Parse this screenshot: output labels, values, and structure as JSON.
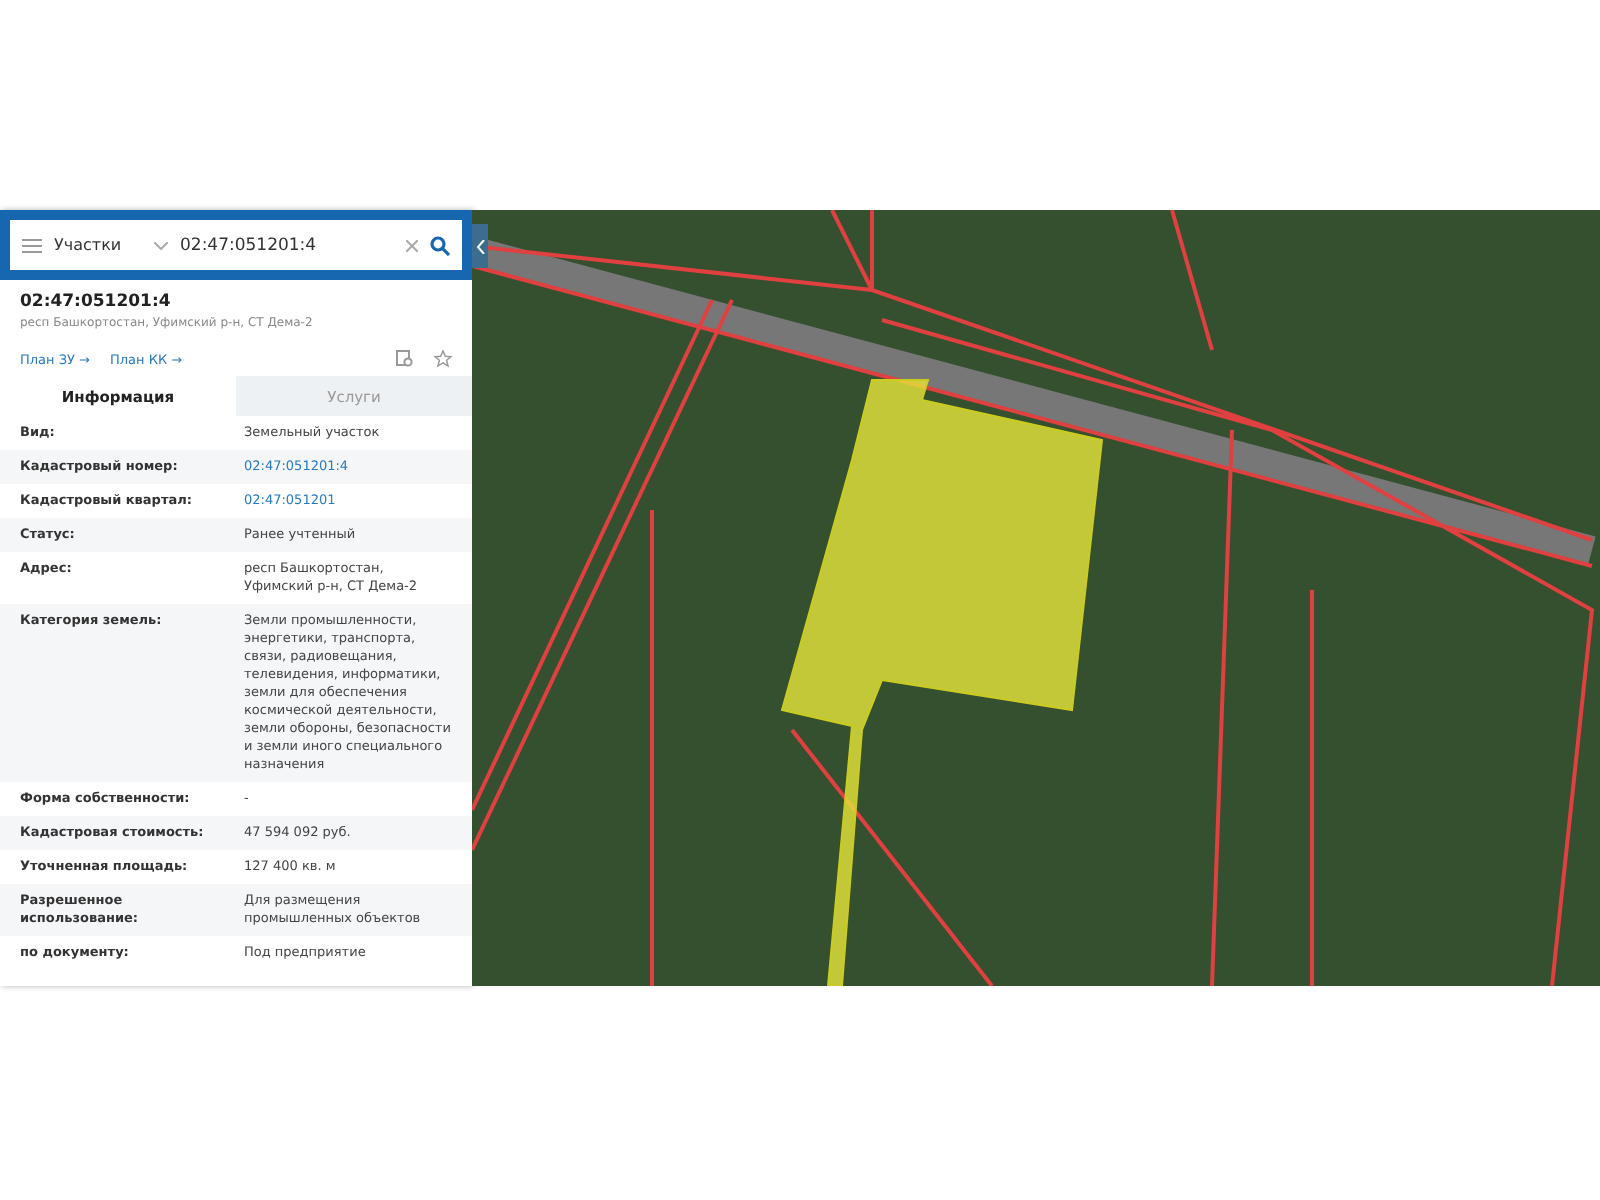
{
  "search": {
    "category": "Участки",
    "query": "02:47:051201:4"
  },
  "object": {
    "title": "02:47:051201:4",
    "address": "респ Башкортостан, Уфимский р-н, СТ Дема-2"
  },
  "links": [
    "План ЗУ →",
    "План КК →"
  ],
  "tabs": [
    {
      "label": "Информация",
      "selected": true
    },
    {
      "label": "Услуги",
      "selected": false
    }
  ],
  "rows": [
    {
      "label": "Вид:",
      "value": "Земельный участок",
      "kind": "text"
    },
    {
      "label": "Кадастровый номер:",
      "value": "02:47:051201:4",
      "kind": "link"
    },
    {
      "label": "Кадастровый квартал:",
      "value": "02:47:051201",
      "kind": "link"
    },
    {
      "label": "Статус:",
      "value": "Ранее учтенный",
      "kind": "text"
    },
    {
      "label": "Адрес:",
      "value": "респ Башкортостан, Уфимский р-н, СТ Дема-2",
      "kind": "text"
    },
    {
      "label": "Категория земель:",
      "value": "Земли промышленности, энергетики, транспорта, связи, радиовещания, телевидения, информатики, земли для обеспечения космической деятельности, земли обороны, безопасности и земли иного специального назначения",
      "kind": "text"
    },
    {
      "label": "Форма собственности:",
      "value": "-",
      "kind": "text"
    },
    {
      "label": "Кадастровая стоимость:",
      "value": "47 594 092 руб.",
      "kind": "text"
    },
    {
      "label": "Уточненная площадь:",
      "value": "127 400 кв. м",
      "kind": "text"
    },
    {
      "label": "Разрешенное использование:",
      "value": "Для размещения промышленных объектов",
      "kind": "text"
    },
    {
      "label": "по документу:",
      "value": "Под предприятие",
      "kind": "text"
    }
  ]
}
